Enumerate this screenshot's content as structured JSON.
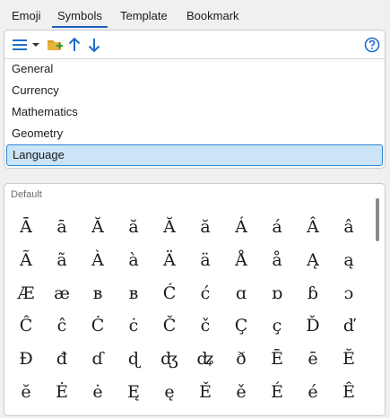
{
  "tabs": [
    "Emoji",
    "Symbols",
    "Template",
    "Bookmark"
  ],
  "active_tab": "Symbols",
  "toolbar": {
    "icons": [
      "list-icon",
      "dropdown-arrow-icon",
      "add-folder-icon",
      "arrow-up-icon",
      "arrow-down-icon",
      "help-icon"
    ],
    "accent_color": "#1f6fc9",
    "folder_color": "#e8b13c"
  },
  "categories": [
    "General",
    "Currency",
    "Mathematics",
    "Geometry",
    "Language"
  ],
  "selected_category": "Language",
  "grid": {
    "label": "Default",
    "symbols": [
      [
        "Ā",
        "ā",
        "Ă",
        "ă",
        "Ă",
        "ă",
        "Á",
        "á",
        "Â",
        "â"
      ],
      [
        "Ã",
        "ã",
        "À",
        "à",
        "Ä",
        "ä",
        "Å",
        "å",
        "Ą",
        "ą"
      ],
      [
        "Æ",
        "æ",
        "ʙ",
        "в",
        "Ć",
        "ć",
        "ɑ",
        "ɒ",
        "ɓ",
        "ɔ"
      ],
      [
        "Ĉ",
        "ĉ",
        "Ċ",
        "ċ",
        "Č",
        "č",
        "Ç",
        "ç",
        "Ď",
        "ď"
      ],
      [
        "Đ",
        "đ",
        "ɗ",
        "ɖ",
        "ʤ",
        "ʥ",
        "ð",
        "Ē",
        "ē",
        "Ĕ"
      ],
      [
        "ĕ",
        "Ė",
        "ė",
        "Ę",
        "ę",
        "Ě",
        "ě",
        "É",
        "é",
        "Ê"
      ]
    ]
  },
  "colors": {
    "selection_bg": "#cce4f7",
    "selection_border": "#2a86d9",
    "tab_underline": "#1f5fb8"
  }
}
